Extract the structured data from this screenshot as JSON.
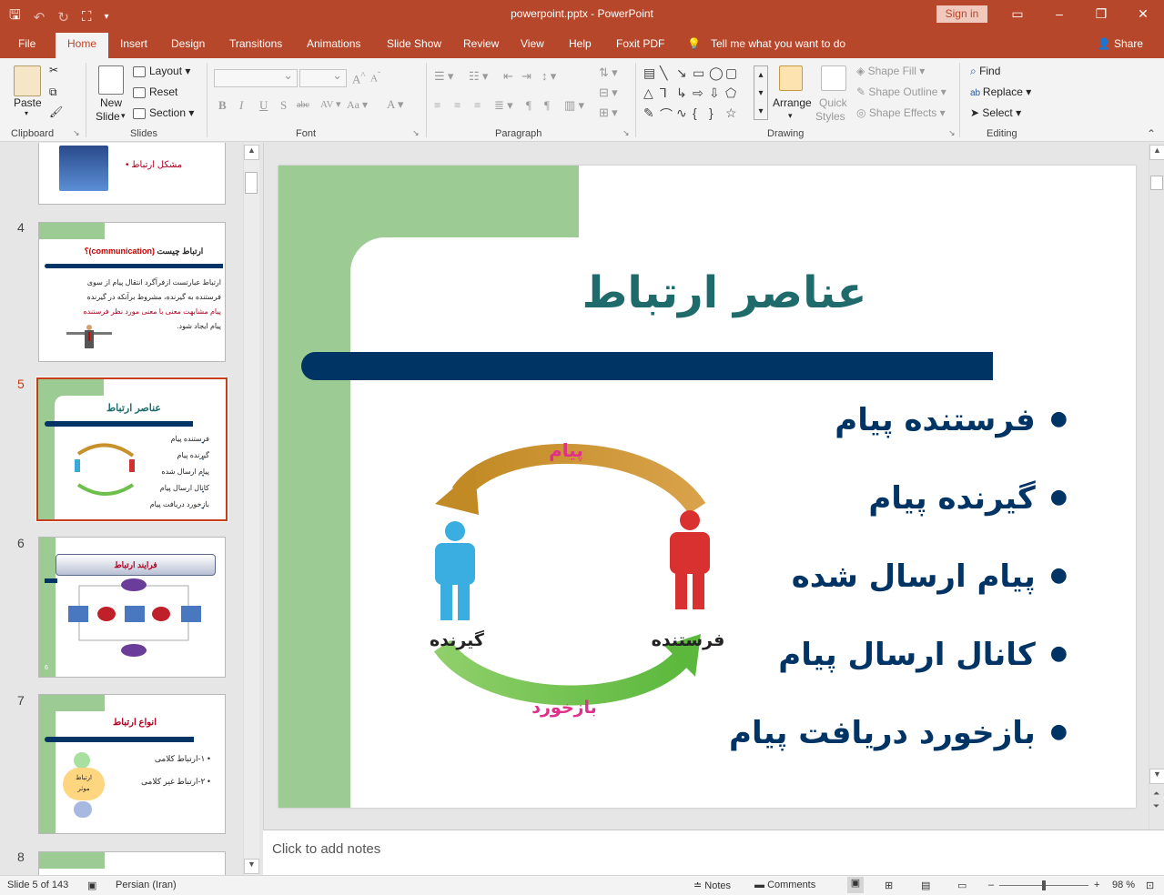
{
  "window": {
    "title": "powerpoint.pptx  -  PowerPoint",
    "signin": "Sign in"
  },
  "tabs": [
    "File",
    "Home",
    "Insert",
    "Design",
    "Transitions",
    "Animations",
    "Slide Show",
    "Review",
    "View",
    "Help",
    "Foxit PDF"
  ],
  "tell_me": "Tell me what you want to do",
  "share": "Share",
  "ribbon": {
    "clipboard": {
      "label": "Clipboard",
      "paste": "Paste"
    },
    "slides": {
      "label": "Slides",
      "new_slide_1": "New",
      "new_slide_2": "Slide",
      "layout": "Layout",
      "reset": "Reset",
      "section": "Section"
    },
    "font": {
      "label": "Font"
    },
    "paragraph": {
      "label": "Paragraph"
    },
    "drawing": {
      "label": "Drawing",
      "arrange": "Arrange",
      "quick_styles_1": "Quick",
      "quick_styles_2": "Styles",
      "shape_fill": "Shape Fill",
      "shape_outline": "Shape Outline",
      "shape_effects": "Shape Effects"
    },
    "editing": {
      "label": "Editing",
      "find": "Find",
      "replace": "Replace",
      "select": "Select"
    }
  },
  "thumbnails": {
    "partial_top": {
      "bullet": "مشکل ارتباط"
    },
    "slide4": {
      "num": "4",
      "title_fa": "ارتباط چیست",
      "title_en": "(communication)؟",
      "body_1": "ارتباط عبارتست ازفرآگرد انتقال پیام از سوی",
      "body_2": "فرستنده به گیرنده، مشروط برآنکه در گیرنده",
      "body_3": "پیام مشابهت معنی با معنی مورد نظر فرستنده",
      "body_4": "پیام ایجاد شود."
    },
    "slide5": {
      "num": "5",
      "title": "عناصر ارتباط",
      "bullets": [
        "فرستنده پیام",
        "گیرنده پیام",
        "پیام ارسال شده",
        "کانال ارسال پیام",
        "بازخورد دریافت پیام"
      ]
    },
    "slide6": {
      "num": "6",
      "title": "فرایند ارتباط",
      "page": "6"
    },
    "slide7": {
      "num": "7",
      "title": "انواع ارتباط",
      "items": [
        "۱-ارتباط کلامی",
        "۲-ارتباط غیر کلامی"
      ],
      "circle_main_1": "ارتباط",
      "circle_main_2": "موثر"
    },
    "slide8": {
      "num": "8"
    }
  },
  "slide": {
    "title": "عناصر ارتباط",
    "bullets": [
      "فرستنده پیام",
      "گیرنده پیام",
      "پیام ارسال شده",
      "کانال ارسال پیام",
      "بازخورد دریافت پیام"
    ],
    "diagram": {
      "message": "پیام",
      "feedback": "بازخورد",
      "receiver": "گیرنده",
      "sender": "فرستنده"
    },
    "colors": {
      "green": "#9ccb94",
      "navy": "#003464",
      "title": "#1f6b6b"
    }
  },
  "notes_placeholder": "Click to add notes",
  "status": {
    "slide_of": "Slide 5 of 143",
    "language": "Persian (Iran)",
    "notes": "Notes",
    "comments": "Comments",
    "zoom": "98 %"
  }
}
